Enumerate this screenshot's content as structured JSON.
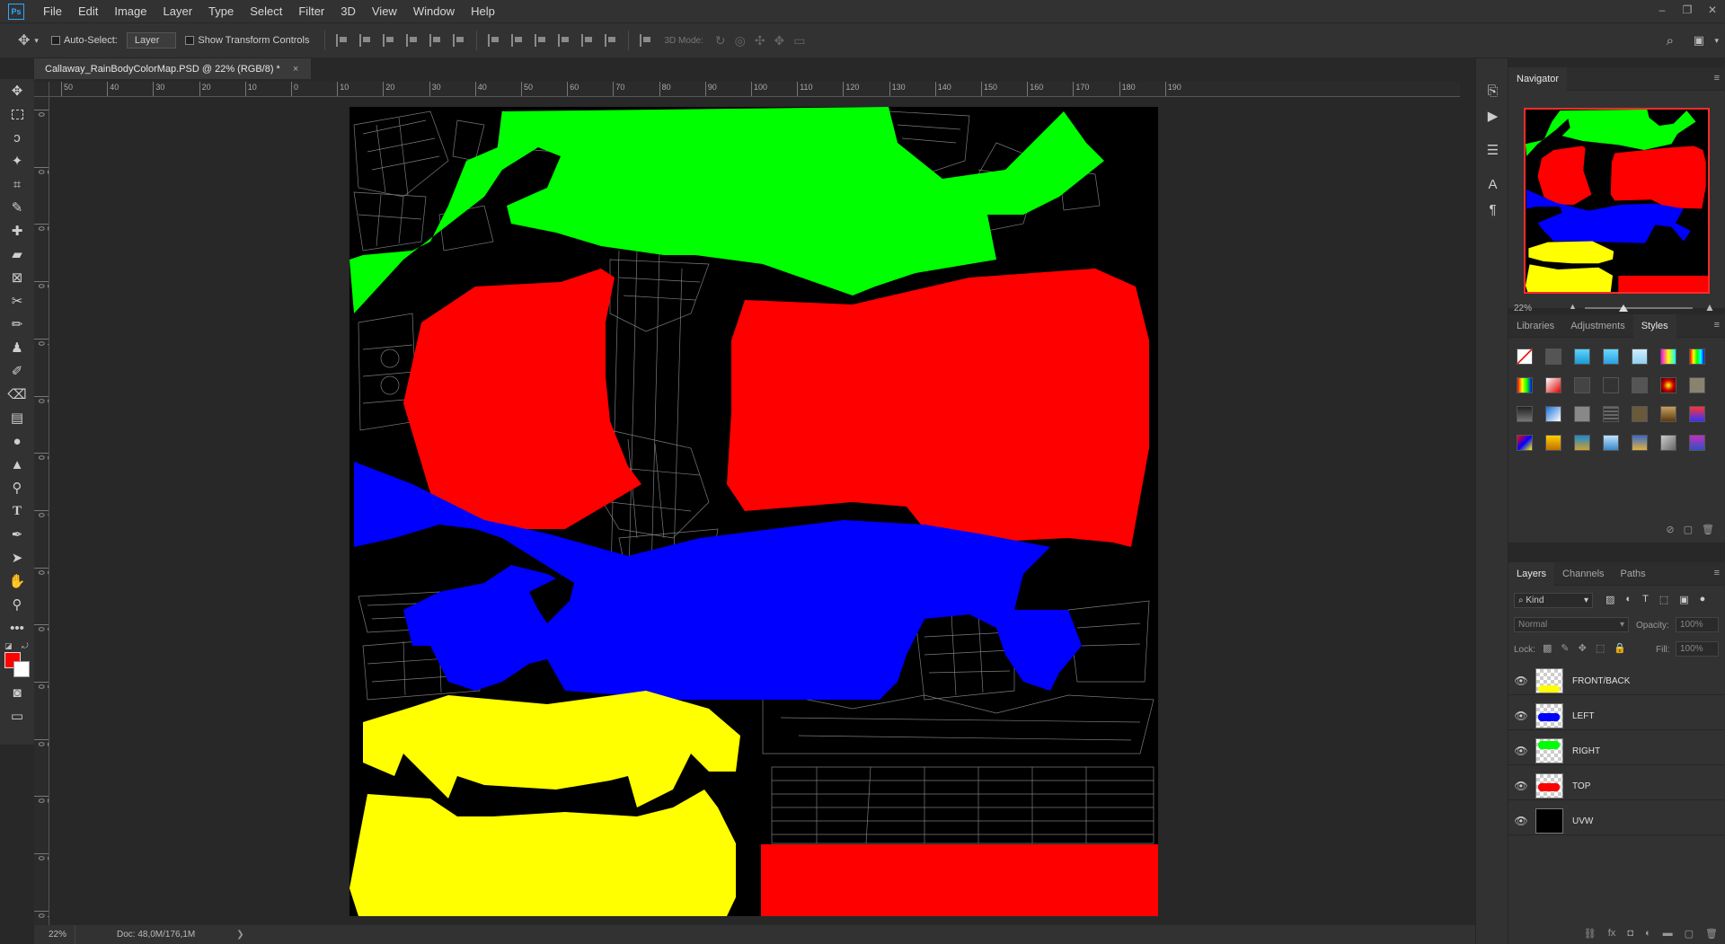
{
  "app": {
    "logo": "Ps"
  },
  "menu": [
    "File",
    "Edit",
    "Image",
    "Layer",
    "Type",
    "Select",
    "Filter",
    "3D",
    "View",
    "Window",
    "Help"
  ],
  "window_controls": [
    "–",
    "❐",
    "✕"
  ],
  "options_bar": {
    "auto_select_label": "Auto-Select:",
    "auto_select_target": "Layer",
    "show_transform_label": "Show Transform Controls",
    "mode_3d_label": "3D Mode:"
  },
  "document": {
    "tab_title": "Callaway_RainBodyColorMap.PSD @ 22% (RGB/8) *",
    "close_glyph": "×",
    "zoom": "22%",
    "doc_size": "Doc: 48,0M/176,1M",
    "status_arrow": "❯"
  },
  "ruler": {
    "h_labels": [
      "50",
      "40",
      "30",
      "20",
      "10",
      "0",
      "10",
      "20",
      "30",
      "40",
      "50",
      "60",
      "70",
      "80",
      "90",
      "100",
      "110",
      "120",
      "130",
      "140",
      "150",
      "160",
      "170",
      "180",
      "190"
    ],
    "v_labels": [
      "0",
      "1 0",
      "2 0",
      "3 0",
      "4 0",
      "5 0",
      "6 0",
      "7 0",
      "8 0",
      "9 0",
      "1 0 0",
      "1 1 0",
      "1 2 0",
      "1 3 0",
      "1 4 0"
    ]
  },
  "colors": {
    "foreground": "#ff0000",
    "background": "#ffffff",
    "uv_green": "#00ff00",
    "uv_red": "#ff0000",
    "uv_blue": "#0000ff",
    "uv_yellow": "#ffff00"
  },
  "tools": [
    "move-tool",
    "marquee-tool",
    "lasso-tool",
    "magic-wand-tool",
    "crop-tool",
    "eyedropper-tool",
    "healing-brush-tool",
    "patch-tool",
    "frame-tool",
    "transform-tool",
    "brush-tool",
    "stamp-tool",
    "history-brush-tool",
    "eraser-tool",
    "gradient-tool",
    "blur-tool",
    "sharpen-tool",
    "dodge-tool",
    "type-tool",
    "pen-tool",
    "path-selection-tool",
    "rotate-tool",
    "zoom-tool",
    "more-tools"
  ],
  "navigator": {
    "title": "Navigator",
    "zoom": "22%"
  },
  "styles_panel": {
    "tabs": [
      "Libraries",
      "Adjustments",
      "Styles"
    ],
    "active": "Styles"
  },
  "layers_panel": {
    "tabs": [
      "Layers",
      "Channels",
      "Paths"
    ],
    "active": "Layers",
    "filter_label": "Kind",
    "blend_mode": "Normal",
    "opacity_label": "Opacity:",
    "opacity_value": "100%",
    "lock_label": "Lock:",
    "fill_label": "Fill:",
    "fill_value": "100%",
    "layers": [
      {
        "name": "FRONT/BACK",
        "thumb_color": "#ffff00"
      },
      {
        "name": "LEFT",
        "thumb_color": "#0000ff"
      },
      {
        "name": "RIGHT",
        "thumb_color": "#00ff00"
      },
      {
        "name": "TOP",
        "thumb_color": "#ff0000"
      },
      {
        "name": "UVW",
        "thumb_color": "#000000"
      }
    ]
  }
}
